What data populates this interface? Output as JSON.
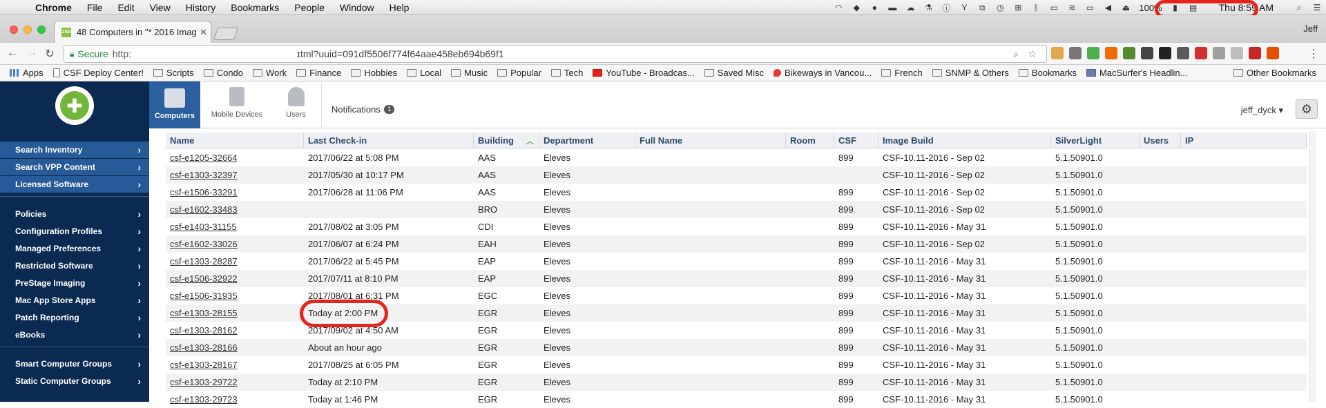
{
  "menubar": {
    "app": "Chrome",
    "items": [
      "File",
      "Edit",
      "View",
      "History",
      "Bookmarks",
      "People",
      "Window",
      "Help"
    ],
    "battery": "100%",
    "clock": "Thu 8:59 AM"
  },
  "browser": {
    "tab_title": "48 Computers in \"* 2016 Imag",
    "favicon_text": "JSS",
    "profile": "Jeff",
    "secure_label": "Secure",
    "scheme": "http:",
    "url": "ɪtml?uuid=091df5506f774f64aae458eb694b69f1"
  },
  "bookmarks": [
    "Apps",
    "CSF Deploy Center!",
    "Scripts",
    "Condo",
    "Work",
    "Finance",
    "Hobbies",
    "Local",
    "Music",
    "Popular",
    "Tech",
    "YouTube - Broadcas...",
    "Saved Misc",
    "Bikeways in Vancou...",
    "French",
    "SNMP & Others",
    "Bookmarks",
    "MacSurfer's Headlin..."
  ],
  "bookmarks_other": "Other Bookmarks",
  "header": {
    "tabs": [
      "Computers",
      "Mobile Devices",
      "Users"
    ],
    "notifications_label": "Notifications",
    "notifications_count": "1",
    "user": "jeff_dyck"
  },
  "sidebar": {
    "group1": [
      "Search Inventory",
      "Search VPP Content",
      "Licensed Software"
    ],
    "group2": [
      "Policies",
      "Configuration Profiles",
      "Managed Preferences",
      "Restricted Software",
      "PreStage Imaging",
      "Mac App Store Apps",
      "Patch Reporting",
      "eBooks"
    ],
    "group3": [
      "Smart Computer Groups",
      "Static Computer Groups"
    ]
  },
  "table": {
    "columns": [
      "Name",
      "Last Check-in",
      "Building",
      "Department",
      "Full Name",
      "Room",
      "CSF",
      "Image Build",
      "SilverLight",
      "Users",
      "IP"
    ],
    "rows": [
      [
        "csf-e1205-32664",
        "2017/06/22 at 5:08 PM",
        "AAS",
        "Eleves",
        "",
        "",
        "899",
        "CSF-10.11-2016 - Sep 02",
        "5.1.50901.0"
      ],
      [
        "csf-e1303-32397",
        "2017/05/30 at 10:17 PM",
        "AAS",
        "Eleves",
        "",
        "",
        "",
        "CSF-10.11-2016 - Sep 02",
        "5.1.50901.0"
      ],
      [
        "csf-e1506-33291",
        "2017/06/28 at 11:06 PM",
        "AAS",
        "Eleves",
        "",
        "",
        "899",
        "CSF-10.11-2016 - Sep 02",
        "5.1.50901.0"
      ],
      [
        "csf-e1602-33483",
        "",
        "BRO",
        "Eleves",
        "",
        "",
        "899",
        "CSF-10.11-2016 - Sep 02",
        "5.1.50901.0"
      ],
      [
        "csf-e1403-31155",
        "2017/08/02 at 3:05 PM",
        "CDI",
        "Eleves",
        "",
        "",
        "899",
        "CSF-10.11-2016 - May 31",
        "5.1.50901.0"
      ],
      [
        "csf-e1602-33026",
        "2017/06/07 at 6:24 PM",
        "EAH",
        "Eleves",
        "",
        "",
        "899",
        "CSF-10.11-2016 - Sep 02",
        "5.1.50901.0"
      ],
      [
        "csf-e1303-28287",
        "2017/06/22 at 5:45 PM",
        "EAP",
        "Eleves",
        "",
        "",
        "899",
        "CSF-10.11-2016 - May 31",
        "5.1.50901.0"
      ],
      [
        "csf-e1506-32922",
        "2017/07/11 at 8:10 PM",
        "EAP",
        "Eleves",
        "",
        "",
        "899",
        "CSF-10.11-2016 - May 31",
        "5.1.50901.0"
      ],
      [
        "csf-e1506-31935",
        "2017/08/01 at 6:31 PM",
        "EGC",
        "Eleves",
        "",
        "",
        "899",
        "CSF-10.11-2016 - May 31",
        "5.1.50901.0"
      ],
      [
        "csf-e1303-28155",
        "Today at 2:00 PM",
        "EGR",
        "Eleves",
        "",
        "",
        "899",
        "CSF-10.11-2016 - May 31",
        "5.1.50901.0"
      ],
      [
        "csf-e1303-28162",
        "2017/09/02 at 4:50 AM",
        "EGR",
        "Eleves",
        "",
        "",
        "899",
        "CSF-10.11-2016 - May 31",
        "5.1.50901.0"
      ],
      [
        "csf-e1303-28166",
        "About an hour ago",
        "EGR",
        "Eleves",
        "",
        "",
        "899",
        "CSF-10.11-2016 - May 31",
        "5.1.50901.0"
      ],
      [
        "csf-e1303-28167",
        "2017/08/25 at 6:05 PM",
        "EGR",
        "Eleves",
        "",
        "",
        "899",
        "CSF-10.11-2016 - May 31",
        "5.1.50901.0"
      ],
      [
        "csf-e1303-29722",
        "Today at 2:10 PM",
        "EGR",
        "Eleves",
        "",
        "",
        "899",
        "CSF-10.11-2016 - May 31",
        "5.1.50901.0"
      ],
      [
        "csf-e1303-29723",
        "Today at 1:46 PM",
        "EGR",
        "Eleves",
        "",
        "",
        "899",
        "CSF-10.11-2016 - May 31",
        "5.1.50901.0"
      ]
    ]
  },
  "colors": {
    "sidebar_bg": "#0b2a52",
    "sidebar_highlight": "#275a98",
    "annotation_red": "#e8231b",
    "jamf_green": "#72b63b"
  }
}
